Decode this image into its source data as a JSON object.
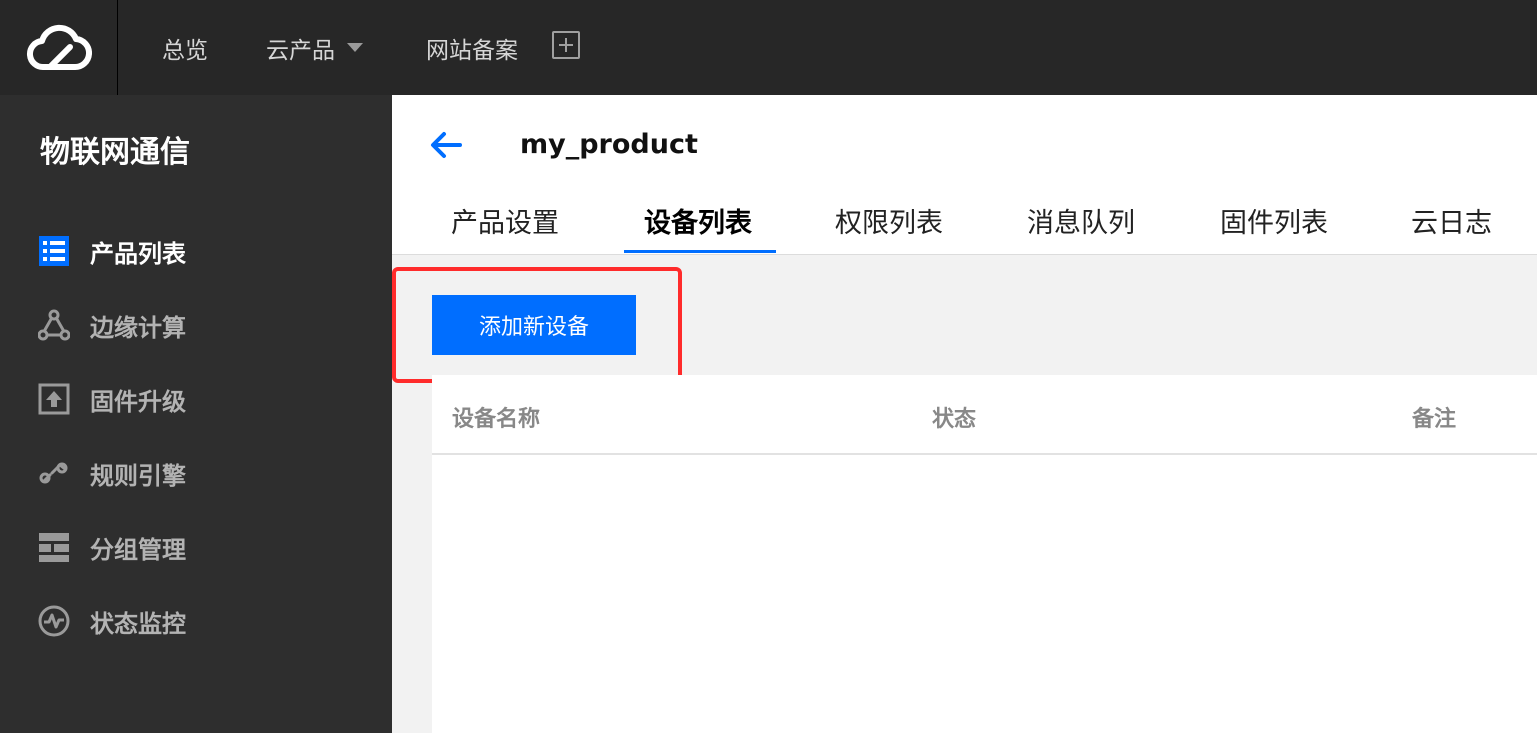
{
  "topbar": {
    "logo_icon": "cloud-logo-icon",
    "nav": [
      {
        "label": "总览"
      },
      {
        "label": "云产品"
      },
      {
        "label": "网站备案"
      }
    ],
    "add_icon": "plus-square-icon"
  },
  "sidebar": {
    "title": "物联网通信",
    "items": [
      {
        "label": "产品列表",
        "icon": "list-icon",
        "active": true
      },
      {
        "label": "边缘计算",
        "icon": "edge-compute-icon",
        "active": false
      },
      {
        "label": "固件升级",
        "icon": "upload-icon",
        "active": false
      },
      {
        "label": "规则引擎",
        "icon": "link-icon",
        "active": false
      },
      {
        "label": "分组管理",
        "icon": "group-icon",
        "active": false
      },
      {
        "label": "状态监控",
        "icon": "pulse-icon",
        "active": false
      }
    ]
  },
  "header": {
    "back_icon": "arrow-left-icon",
    "product_name": "my_product",
    "tabs": [
      {
        "label": "产品设置"
      },
      {
        "label": "设备列表",
        "active": true
      },
      {
        "label": "权限列表"
      },
      {
        "label": "消息队列"
      },
      {
        "label": "固件列表"
      },
      {
        "label": "云日志"
      }
    ]
  },
  "actions": {
    "add_device_label": "添加新设备"
  },
  "table": {
    "columns": [
      "设备名称",
      "状态",
      "备注"
    ],
    "rows": []
  },
  "colors": {
    "accent": "#006eff",
    "highlight": "#ff2b2b",
    "topbar_bg": "#272727",
    "sidebar_bg": "#2e2e2e"
  }
}
